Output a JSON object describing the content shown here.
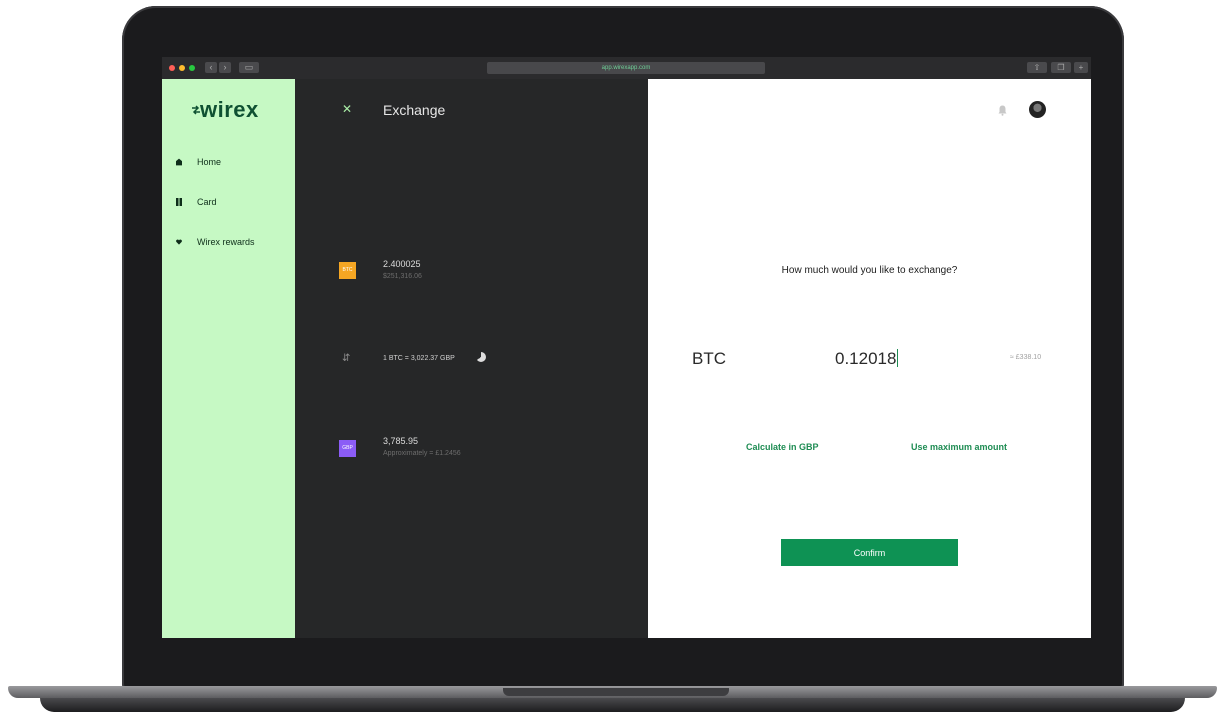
{
  "browser": {
    "url": "app.wirexapp.com"
  },
  "sidebar": {
    "logo": "wirex",
    "items": [
      {
        "label": "Home",
        "icon": "home-icon"
      },
      {
        "label": "Card",
        "icon": "card-icon"
      },
      {
        "label": "Wirex rewards",
        "icon": "heart-icon"
      }
    ]
  },
  "exchange_panel": {
    "title": "Exchange",
    "from_asset": {
      "badge": "BTC",
      "amount": "2.400025",
      "fiat": "$251,316.06",
      "color": "#f5a623"
    },
    "rate": "1 BTC = 3,022.37 GBP",
    "to_asset": {
      "badge": "GBP",
      "amount": "3,785.95",
      "fiat": "Approximately = £1.2456",
      "color": "#8b5cf6"
    }
  },
  "main": {
    "question": "How much would you like to exchange?",
    "currency": "BTC",
    "amount": "0.12018",
    "fiat_equiv": "≈ £338.10",
    "calc_link": "Calculate in GBP",
    "max_link": "Use maximum amount",
    "confirm_label": "Confirm"
  },
  "colors": {
    "sidebar_bg": "#c6f9c4",
    "panel_bg": "#262728",
    "accent": "#0e9254"
  }
}
